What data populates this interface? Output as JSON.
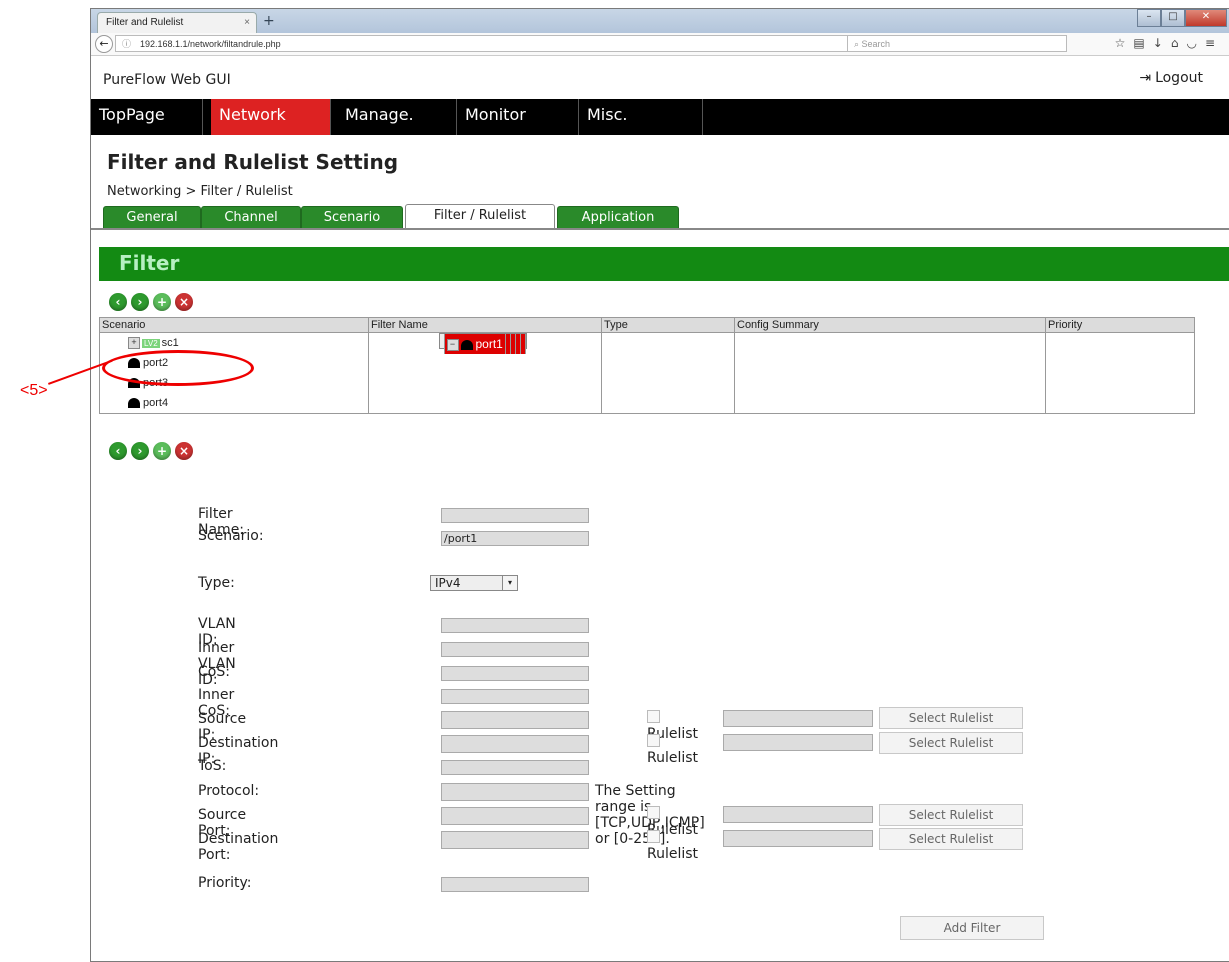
{
  "browser": {
    "tab_title": "Filter and Rulelist",
    "tab_close": "×",
    "new_tab": "+",
    "url": "192.168.1.1/network/filtandrule.php",
    "search_placeholder": "Search",
    "window_controls": [
      "minimize-icon",
      "maximize-icon",
      "close-icon"
    ]
  },
  "app": {
    "title": "PureFlow Web GUI",
    "logout": "Logout"
  },
  "menu": {
    "items": [
      {
        "label": "TopPage"
      },
      {
        "label": "Network",
        "active": true
      },
      {
        "label": "Manage."
      },
      {
        "label": "Monitor"
      },
      {
        "label": "Misc."
      }
    ]
  },
  "page": {
    "title": "Filter and Rulelist Setting",
    "breadcrumb": "Networking > Filter / Rulelist"
  },
  "subtabs": [
    "General",
    "Channel",
    "Scenario",
    "Filter / Rulelist",
    "Application"
  ],
  "filter": {
    "heading": "Filter",
    "table": {
      "headers": [
        "Scenario",
        "Filter Name",
        "Type",
        "Config Summary",
        "Priority"
      ],
      "rows": [
        {
          "expander": "−",
          "icon": "port-icon",
          "label": "port1",
          "selected": true
        },
        {
          "expander": "+",
          "badge": "LV2",
          "label": "sc1"
        },
        {
          "icon": "port-icon",
          "label": "port2"
        },
        {
          "icon": "port-icon",
          "label": "port3"
        },
        {
          "icon": "port-icon",
          "label": "port4"
        }
      ]
    }
  },
  "form": {
    "filter_name_label": "Filter Name:",
    "scenario_label": "Scenario:",
    "scenario_value": "/port1",
    "type_label": "Type:",
    "type_value": "IPv4",
    "vlan_label": "VLAN ID:",
    "inner_vlan_label": "Inner VLAN ID:",
    "cos_label": "CoS:",
    "inner_cos_label": "Inner CoS:",
    "source_ip_label": "Source IP:",
    "dest_ip_label": "Destination IP:",
    "tos_label": "ToS:",
    "protocol_label": "Protocol:",
    "protocol_note": "The Setting range is [TCP,UDP,ICMP] or [0-255].",
    "source_port_label": "Source Port:",
    "dest_port_label": "Destination Port:",
    "priority_label": "Priority:",
    "rulelist_label": "Rulelist",
    "select_rulelist": "Select Rulelist",
    "add_filter": "Add Filter"
  },
  "annotation": {
    "label": "<5>",
    "color": "#ee0000"
  }
}
